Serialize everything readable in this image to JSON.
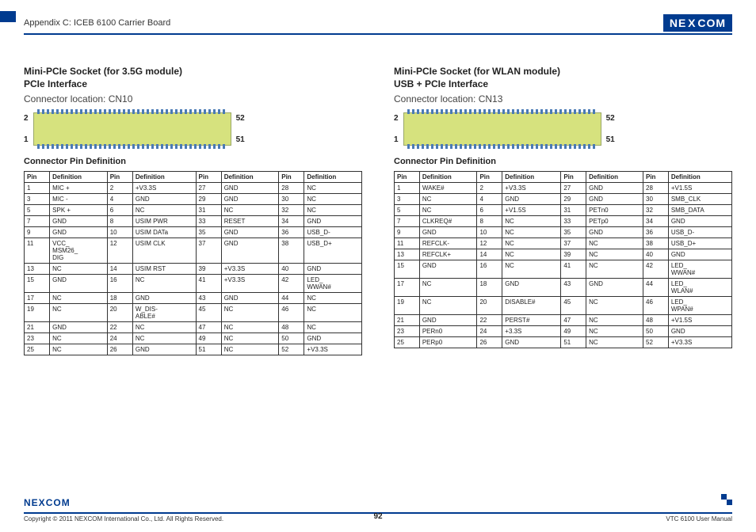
{
  "header": {
    "title": "Appendix C: ICEB 6100 Carrier Board"
  },
  "logo": {
    "n": "NE",
    "x": "X",
    "com": "COM"
  },
  "left": {
    "title1": "Mini-PCIe Socket (for 3.5G module)",
    "title2": "PCIe Interface",
    "sub": "Connector location: CN10",
    "pin_tl": "2",
    "pin_bl": "1",
    "pin_tr": "52",
    "pin_br": "51",
    "pin_def_title": "Connector Pin Definition",
    "headers": [
      "Pin",
      "Definition",
      "Pin",
      "Definition",
      "Pin",
      "Definition",
      "Pin",
      "Definition"
    ],
    "rows": [
      [
        "1",
        "MIC +",
        "2",
        "+V3.3S",
        "27",
        "GND",
        "28",
        "NC"
      ],
      [
        "3",
        "MIC -",
        "4",
        "GND",
        "29",
        "GND",
        "30",
        "NC"
      ],
      [
        "5",
        "SPK +",
        "6",
        "NC",
        "31",
        "NC",
        "32",
        "NC"
      ],
      [
        "7",
        "GND",
        "8",
        "USIM PWR",
        "33",
        "RESET",
        "34",
        "GND"
      ],
      [
        "9",
        "GND",
        "10",
        "USIM DATa",
        "35",
        "GND",
        "36",
        "USB_D-"
      ],
      [
        "11",
        "VCC_\nMSM26_\nDIG",
        "12",
        "USIM CLK",
        "37",
        "GND",
        "38",
        "USB_D+"
      ],
      [
        "13",
        "NC",
        "14",
        "USIM RST",
        "39",
        "+V3.3S",
        "40",
        "GND"
      ],
      [
        "15",
        "GND",
        "16",
        "NC",
        "41",
        "+V3.3S",
        "42",
        "LED_\nWWAN#"
      ],
      [
        "17",
        "NC",
        "18",
        "GND",
        "43",
        "GND",
        "44",
        "NC"
      ],
      [
        "19",
        "NC",
        "20",
        "W_DIS-\nABLE#",
        "45",
        "NC",
        "46",
        "NC"
      ],
      [
        "21",
        "GND",
        "22",
        "NC",
        "47",
        "NC",
        "48",
        "NC"
      ],
      [
        "23",
        "NC",
        "24",
        "NC",
        "49",
        "NC",
        "50",
        "GND"
      ],
      [
        "25",
        "NC",
        "26",
        "GND",
        "51",
        "NC",
        "52",
        "+V3.3S"
      ]
    ]
  },
  "right": {
    "title1": "Mini-PCIe Socket (for WLAN module)",
    "title2": "USB + PCIe Interface",
    "sub": "Connector location: CN13",
    "pin_tl": "2",
    "pin_bl": "1",
    "pin_tr": "52",
    "pin_br": "51",
    "pin_def_title": "Connector Pin Definition",
    "headers": [
      "Pin",
      "Definition",
      "Pin",
      "Definition",
      "Pin",
      "Definition",
      "Pin",
      "Definition"
    ],
    "rows": [
      [
        "1",
        "WAKE#",
        "2",
        "+V3.3S",
        "27",
        "GND",
        "28",
        "+V1.5S"
      ],
      [
        "3",
        "NC",
        "4",
        "GND",
        "29",
        "GND",
        "30",
        "SMB_CLK"
      ],
      [
        "5",
        "NC",
        "6",
        "+V1.5S",
        "31",
        "PETn0",
        "32",
        "SMB_DATA"
      ],
      [
        "7",
        "CLKREQ#",
        "8",
        "NC",
        "33",
        "PETp0",
        "34",
        "GND"
      ],
      [
        "9",
        "GND",
        "10",
        "NC",
        "35",
        "GND",
        "36",
        "USB_D-"
      ],
      [
        "11",
        "REFCLK-",
        "12",
        "NC",
        "37",
        "NC",
        "38",
        "USB_D+"
      ],
      [
        "13",
        "REFCLK+",
        "14",
        "NC",
        "39",
        "NC",
        "40",
        "GND"
      ],
      [
        "15",
        "GND",
        "16",
        "NC",
        "41",
        "NC",
        "42",
        "LED_\nWWAN#"
      ],
      [
        "17",
        "NC",
        "18",
        "GND",
        "43",
        "GND",
        "44",
        "LED_\nWLAN#"
      ],
      [
        "19",
        "NC",
        "20",
        "DISABLE#",
        "45",
        "NC",
        "46",
        "LED_\nWPAN#"
      ],
      [
        "21",
        "GND",
        "22",
        "PERST#",
        "47",
        "NC",
        "48",
        "+V1.5S"
      ],
      [
        "23",
        "PERn0",
        "24",
        "+3.3S",
        "49",
        "NC",
        "50",
        "GND"
      ],
      [
        "25",
        "PERp0",
        "26",
        "GND",
        "51",
        "NC",
        "52",
        "+V3.3S"
      ]
    ]
  },
  "footer": {
    "copyright": "Copyright © 2011 NEXCOM International Co., Ltd. All Rights Reserved.",
    "page": "92",
    "manual": "VTC 6100 User Manual"
  }
}
